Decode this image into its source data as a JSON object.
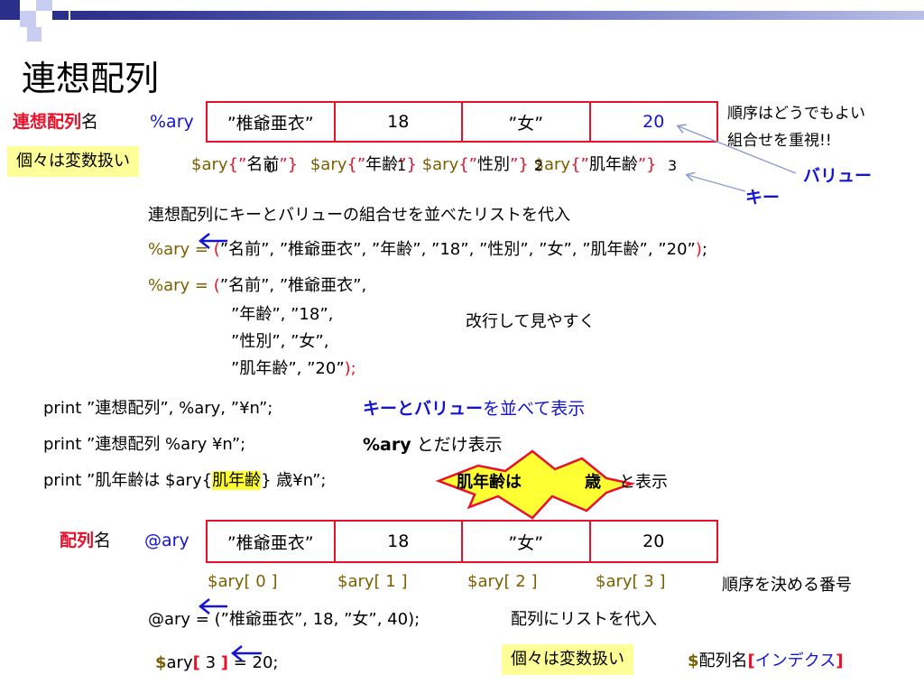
{
  "title": "連想配列",
  "assoc": {
    "label_red": "連想配列",
    "label_black": "名",
    "var": "%ary",
    "cells": [
      "”椎爺亜衣”",
      "18",
      "”女”",
      "20"
    ],
    "note_order_l1": "順序はどうでもよい",
    "note_order_l2": "組合せを重視!!",
    "individual": "個々は変数扱い",
    "accessors": [
      {
        "pre": "$ary",
        "open": "{”",
        "key": "名前",
        "close": "”}",
        "overlay": "0"
      },
      {
        "pre": "$ary",
        "open": "{”",
        "key": "年齢",
        "close": "”}",
        "overlay": "1"
      },
      {
        "pre": "$ary",
        "open": "{”",
        "key": "性別",
        "close": "”}",
        "overlay": "2"
      },
      {
        "pre": "$ary",
        "open": "{”",
        "key": "肌年齢",
        "close": "”}",
        "overlay": "3"
      }
    ],
    "value_label": "バリュー",
    "key_label": "キー"
  },
  "list_assign": {
    "heading": "連想配列にキーとバリューの組合せを並べたリストを代入",
    "line1_pre": "%ary = ",
    "line1_paren_open": "(",
    "line1_body": "”名前”, ”椎爺亜衣”, ”年齢”, ”18”, ”性別”, ”女”, ”肌年齢”, ”20”",
    "line1_paren_close": ")",
    "line1_semi": ";",
    "multi_pre": "%ary = ",
    "multi_l1": "”名前”, ”椎爺亜衣”,",
    "multi_l2": "”年齢”, ”18”,",
    "multi_l3": "”性別”, ”女”,",
    "multi_l4": "”肌年齢”, ”20”",
    "multi_close": ");",
    "note": "改行して見やすく"
  },
  "prints": {
    "p1": "print ”連想配列”, %ary, ”¥n”;",
    "p1_note_blue": "キーとバリュー",
    "p1_note_rest": "を並べて表示",
    "p2": "print ”連想配列 %ary ¥n”;",
    "p2_note_bold": "%ary",
    "p2_note_rest": " とだけ表示",
    "p3_pre": "print ”肌年齢は $ary{",
    "p3_key": "肌年齢",
    "p3_post": "} 歳¥n”;",
    "p3_burst_a": "肌年齢は",
    "p3_burst_b": "歳",
    "p3_note": "と表示"
  },
  "array": {
    "label_red": "配列",
    "label_black": "名",
    "var": "@ary",
    "cells": [
      "”椎爺亜衣”",
      "18",
      "”女”",
      "20"
    ],
    "indexes": [
      "$ary[ 0 ]",
      "$ary[ 1 ]",
      "$ary[ 2 ]",
      "$ary[ 3 ]"
    ],
    "order_note": "順序を決める番号",
    "assign": "@ary = (”椎爺亜衣”, 18, ”女”, 40);",
    "assign_note": "配列にリストを代入",
    "elem_dollar": "$",
    "elem_name": "ary",
    "elem_open": "[",
    "elem_idx": " 3 ",
    "elem_close": "]",
    "elem_rest": " = 20;",
    "individual": "個々は変数扱い",
    "syntax_dollar": "$",
    "syntax_name": "配列名",
    "syntax_open": "[",
    "syntax_idx": "インデクス",
    "syntax_close": "]"
  },
  "colors": {
    "accent_red": "#e8102a",
    "accent_blue": "#1414d6",
    "highlight": "#ffff99",
    "header_navy": "#2a2f8a"
  }
}
